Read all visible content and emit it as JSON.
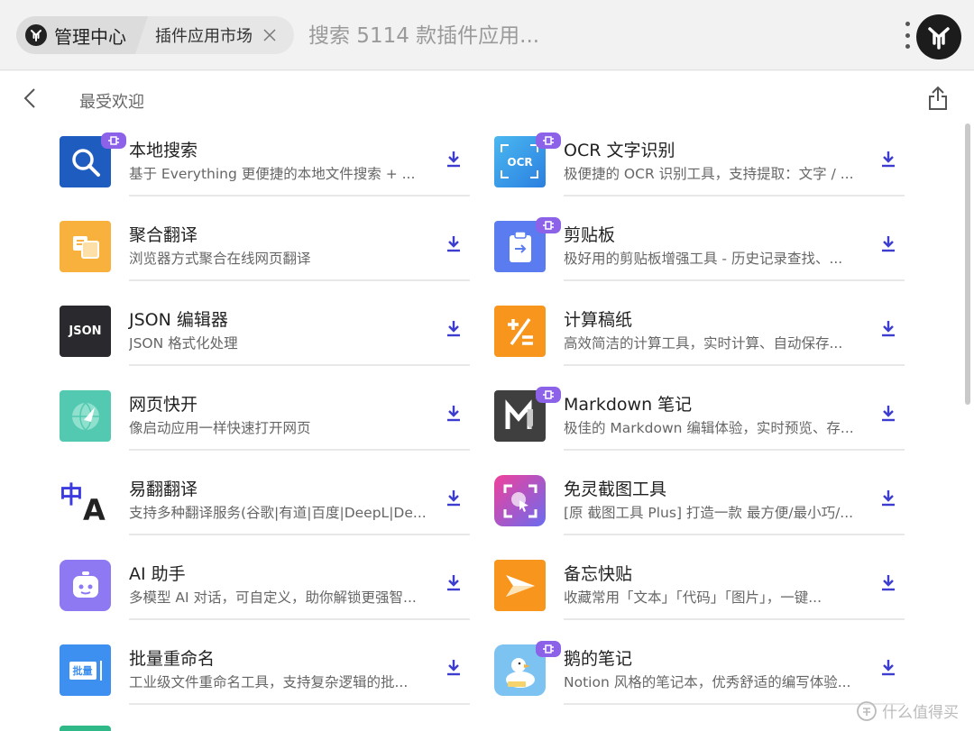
{
  "header": {
    "home_label": "管理中心",
    "tab_label": "插件应用市场",
    "search_placeholder": "搜索 5114 款插件应用..."
  },
  "section": {
    "title": "最受欢迎"
  },
  "plugins_left": [
    {
      "name": "本地搜索",
      "desc": "基于 Everything 更便捷的本地文件搜索 + ...",
      "badge": true
    },
    {
      "name": "聚合翻译",
      "desc": "浏览器方式聚合在线网页翻译",
      "badge": false
    },
    {
      "name": "JSON 编辑器",
      "desc": "JSON 格式化处理",
      "badge": false,
      "icon_text": "JSON"
    },
    {
      "name": "网页快开",
      "desc": "像启动应用一样快速打开网页",
      "badge": false
    },
    {
      "name": "易翻翻译",
      "desc": "支持多种翻译服务(谷歌|有道|百度|DeepL|De...",
      "badge": false,
      "icon_text_1": "中",
      "icon_text_2": "A"
    },
    {
      "name": "AI 助手",
      "desc": "多模型 AI 对话，可自定义，助你解锁更强智...",
      "badge": false
    },
    {
      "name": "批量重命名",
      "desc": "工业级文件重命名工具，支持复杂逻辑的批...",
      "badge": false,
      "icon_text": "批量"
    }
  ],
  "plugins_right": [
    {
      "name": "OCR 文字识别",
      "desc": "极便捷的 OCR 识别工具，支持提取：文字 / ...",
      "badge": true,
      "icon_text": "OCR"
    },
    {
      "name": "剪贴板",
      "desc": "极好用的剪贴板增强工具 - 历史记录查找、...",
      "badge": true
    },
    {
      "name": "计算稿纸",
      "desc": "高效简洁的计算工具，实时计算、自动保存...",
      "badge": false
    },
    {
      "name": "Markdown 笔记",
      "desc": "极佳的 Markdown 编辑体验，实时预览、存...",
      "badge": true
    },
    {
      "name": "免灵截图工具",
      "desc": "[原 截图工具 Plus] 打造一款 最方便/最小巧/...",
      "badge": false
    },
    {
      "name": "备忘快贴",
      "desc": "收藏常用「文本」「代码」「图片」，一键...",
      "badge": false
    },
    {
      "name": "鹅的笔记",
      "desc": "Notion 风格的笔记本，优秀舒适的编写体验...",
      "badge": true
    }
  ],
  "watermark": "什么值得买",
  "colors": {
    "accent": "#3c3ccf",
    "badge": "#8c62e8"
  }
}
